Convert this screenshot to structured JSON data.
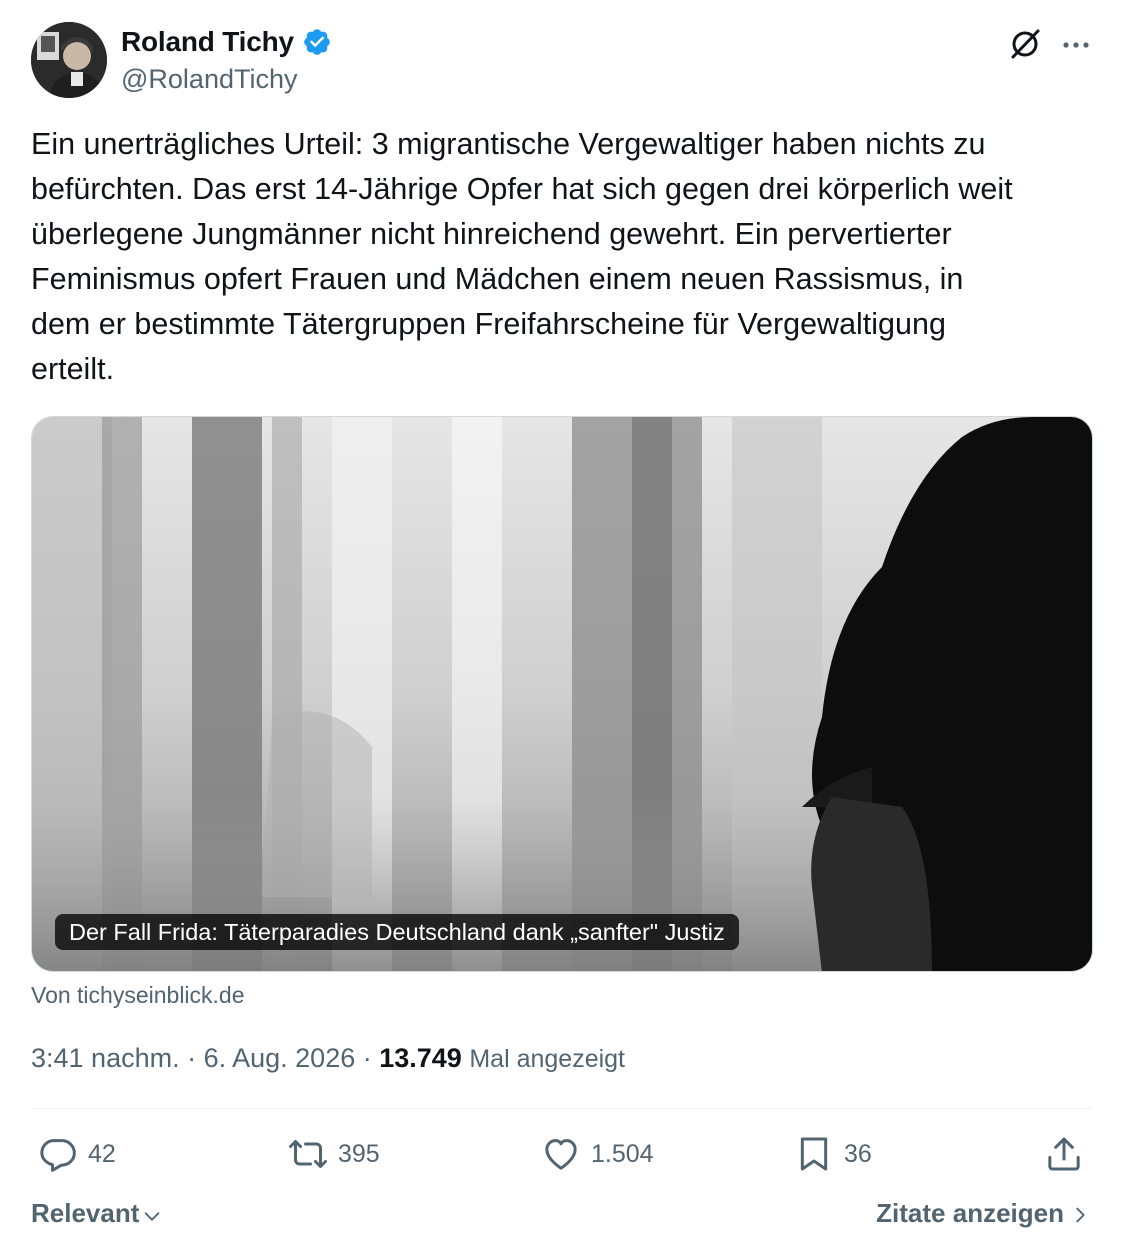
{
  "author": {
    "display_name": "Roland Tichy",
    "handle": "@RolandTichy",
    "verified_icon": "verified-badge-icon"
  },
  "tweet": {
    "text": "Ein unerträgliches Urteil: 3 migrantische Vergewaltiger haben nichts zu\nbefürchten. Das erst 14-Jährige Opfer hat sich gegen drei körperlich weit\nüberlegene Jungmänner nicht hinreichend gewehrt. Ein pervertierter\nFeminismus opfert Frauen und Mädchen einem neuen Rassismus, in\ndem er bestimmte Tätergruppen Freifahrscheine für Vergewaltigung\nerteilt."
  },
  "link_card": {
    "title": "Der Fall Frida: Täterparadies Deutschland dank „sanfter\" Justiz",
    "source": "Von tichyseinblick.de"
  },
  "meta": {
    "time": "3:41 nachm.",
    "separator": " · ",
    "date": "6. Aug. 2026",
    "views_count": "13.749",
    "views_label": "Mal angezeigt"
  },
  "actions": {
    "replies": "42",
    "reposts": "395",
    "likes": "1.504",
    "bookmarks": "36"
  },
  "footer": {
    "sort_label": "Relevant",
    "quotes_label": "Zitate anzeigen"
  },
  "colors": {
    "text_primary": "#0f1419",
    "text_secondary": "#536471",
    "verified_blue": "#1d9bf0",
    "divider": "#eff3f4"
  }
}
